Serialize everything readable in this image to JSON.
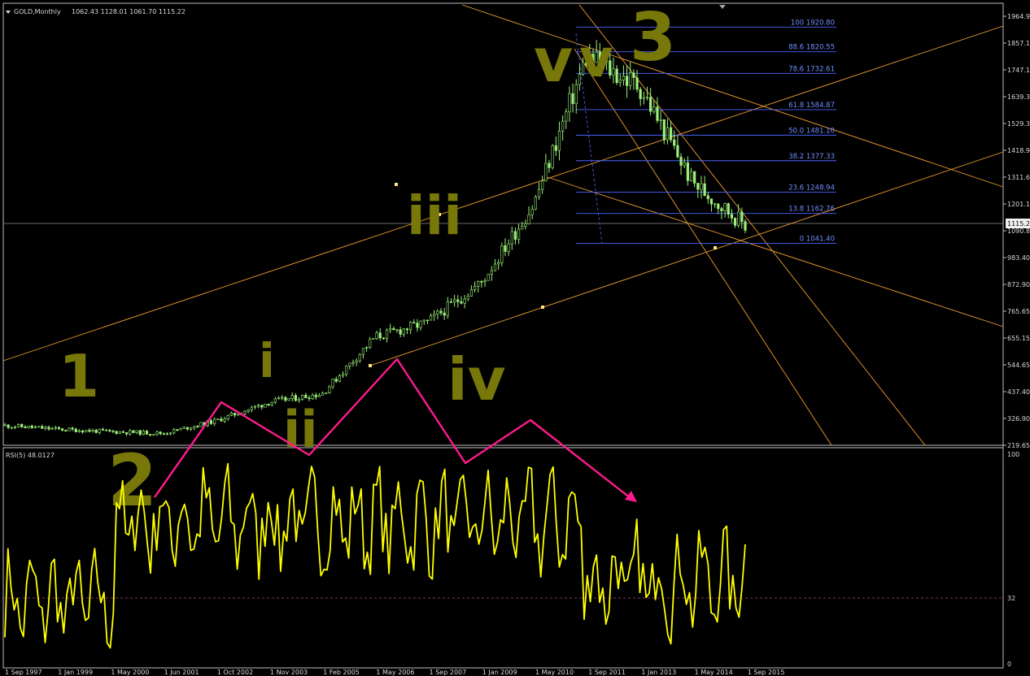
{
  "header": {
    "symbol_label": "GOLD,Monthly",
    "ohlc": "1062.43 1128.01 1061.70 1115.22",
    "dropdown_icon": "triangle-down-icon"
  },
  "rsi_panel": {
    "label": "RSI(5) 48.0127",
    "levels": [
      "100",
      "32",
      "0"
    ]
  },
  "price_axis": {
    "ticks": [
      "1964.90",
      "1857.10",
      "1747.10",
      "1639.30",
      "1529.30",
      "1418.90",
      "1311.65",
      "1201.10",
      "1090.80",
      "983.40",
      "872.90",
      "765.65",
      "655.15",
      "544.65",
      "437.40",
      "326.90",
      "219.65"
    ],
    "current_price": "1115.22"
  },
  "time_axis": {
    "ticks": [
      "1 Sep 1997",
      "1 Jan 1999",
      "1 May 2000",
      "1 Jun 2001",
      "1 Oct 2002",
      "1 Nov 2003",
      "1 Feb 2005",
      "1 May 2006",
      "1 Sep 2007",
      "1 Jan 2009",
      "1 May 2010",
      "1 Sep 2011",
      "1 Jan 2013",
      "1 May 2014",
      "1 Sep 2015"
    ]
  },
  "fibonacci": [
    {
      "level": "100",
      "price": "1920.80"
    },
    {
      "level": "88.6",
      "price": "1820.55"
    },
    {
      "level": "78.6",
      "price": "1732.61"
    },
    {
      "level": "61.8",
      "price": "1584.87"
    },
    {
      "level": "50.0",
      "price": "1481.10"
    },
    {
      "level": "38.2",
      "price": "1377.33"
    },
    {
      "level": "23.6",
      "price": "1248.94"
    },
    {
      "level": "13.8",
      "price": "1162.76"
    },
    {
      "level": "0",
      "price": "1041.40"
    }
  ],
  "colors": {
    "background": "#000000",
    "candle": "#9cf07a",
    "rsi_line": "#ffff00",
    "fib_lines": "#4a64ff",
    "trendlines": "#f0a030",
    "wave_arrows": "#ff1a8c",
    "wave_labels": "#77770a",
    "axis_text": "#d8d8d8"
  },
  "chart_data": {
    "type": "candlestick",
    "title": "GOLD,Monthly",
    "x": [
      "1 Sep 1997",
      "1 Jan 1999",
      "1 May 2000",
      "1 Jun 2001",
      "1 Oct 2002",
      "1 Nov 2003",
      "1 Feb 2005",
      "1 May 2006",
      "1 Sep 2007",
      "1 Jan 2009",
      "1 May 2010",
      "1 Sep 2011",
      "1 Jan 2013",
      "1 May 2014",
      "1 Sep 2015"
    ],
    "close_approx": [
      300,
      285,
      275,
      268,
      320,
      395,
      430,
      660,
      720,
      880,
      1200,
      1800,
      1680,
      1290,
      1115
    ],
    "ylim": [
      219.65,
      1964.9
    ],
    "grid": false,
    "annotations": [
      "1",
      "2",
      "3",
      "i",
      "ii",
      "iii",
      "iv",
      "v"
    ],
    "rsi": {
      "name": "RSI(5)",
      "last": 48.0127,
      "levels": [
        100,
        32,
        0
      ]
    }
  }
}
